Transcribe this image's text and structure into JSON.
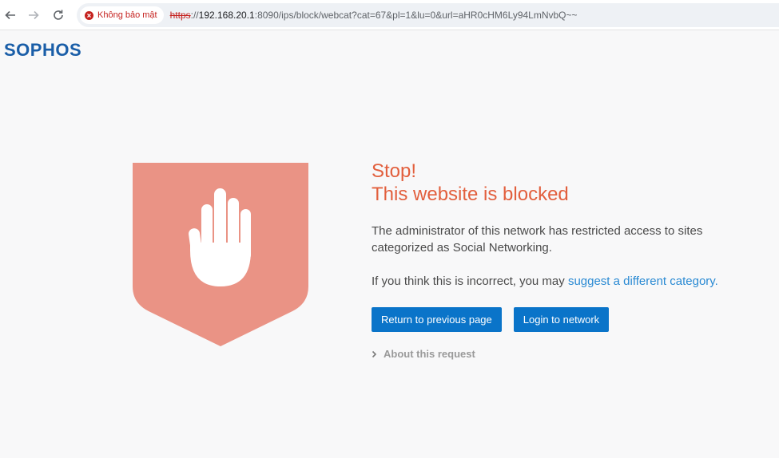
{
  "browser": {
    "security_label": "Không bảo mật",
    "url_scheme": "https",
    "url_sep": "://",
    "url_host": "192.168.20.1",
    "url_rest": ":8090/ips/block/webcat?cat=67&pl=1&lu=0&url=aHR0cHM6Ly94LmNvbQ~~"
  },
  "logo": {
    "text": "SOPHOS"
  },
  "block": {
    "title_line1": "Stop!",
    "title_line2": "This website is blocked",
    "description": "The administrator of this network has restricted access to sites categorized as Social Networking.",
    "suggest_prefix": "If you think this is incorrect, you may ",
    "suggest_link": "suggest a different category.",
    "return_button": "Return to previous page",
    "login_button": "Login to network",
    "about_label": "About this request"
  },
  "colors": {
    "brand": "#1a5ea8",
    "shield": "#ea9385",
    "title": "#e25f3d",
    "button": "#0a74c9",
    "link": "#2a8ad3"
  },
  "icons": [
    "back-arrow-icon",
    "forward-arrow-icon",
    "reload-icon",
    "not-secure-icon",
    "shield-icon",
    "hand-icon",
    "chevron-right-icon"
  ]
}
